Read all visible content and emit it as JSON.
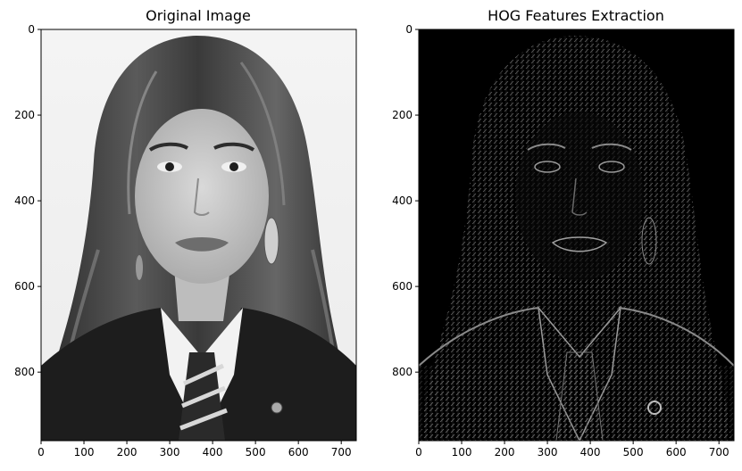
{
  "panels": [
    {
      "id": "original",
      "title": "Original Image",
      "xticks": [
        0,
        100,
        200,
        300,
        400,
        500,
        600,
        700
      ],
      "yticks": [
        0,
        200,
        400,
        600,
        800
      ],
      "xlim": [
        0,
        735
      ],
      "ylim": [
        0,
        960
      ],
      "image_description_icon": "grayscale-portrait-photo"
    },
    {
      "id": "hog",
      "title": "HOG Features Extraction",
      "xticks": [
        0,
        100,
        200,
        300,
        400,
        500,
        600,
        700
      ],
      "yticks": [
        0,
        200,
        400,
        600,
        800
      ],
      "xlim": [
        0,
        735
      ],
      "ylim": [
        0,
        960
      ],
      "image_description_icon": "hog-gradient-visualization"
    }
  ],
  "colors": {
    "frame": "#000000",
    "background": "#ffffff",
    "hog_background": "#000000"
  }
}
